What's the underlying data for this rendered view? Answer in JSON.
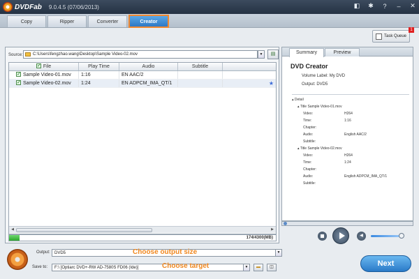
{
  "app": {
    "name": "DVDFab",
    "version": "9.0.4.5 (07/06/2013)"
  },
  "tabs": [
    {
      "label": "Copy"
    },
    {
      "label": "Ripper"
    },
    {
      "label": "Converter"
    },
    {
      "label": "Creator"
    }
  ],
  "task_queue": {
    "label": "Task Queue",
    "badge": "1"
  },
  "source": {
    "label": "Source:",
    "path": "C:\\Users\\fengzhao.wang\\Desktop\\Sample Video-02.mov"
  },
  "grid": {
    "headers": [
      "File",
      "Play Time",
      "Audio",
      "Subtitle"
    ],
    "rows": [
      {
        "file": "Sample Video-01.mov",
        "time": "1:16",
        "audio": "EN AAC/2",
        "subtitle": ""
      },
      {
        "file": "Sample Video-02.mov",
        "time": "1:24",
        "audio": "EN ADPCM_IMA_QT/1",
        "subtitle": ""
      }
    ]
  },
  "progress": {
    "text": "174/4300(MB)",
    "fraction": 0.04
  },
  "summary": {
    "tabs": [
      "Summary",
      "Preview"
    ],
    "title": "DVD Creator",
    "volume_label": "Volume Label: My DVD",
    "output": "Output: DVD5",
    "detail_label": "Detail",
    "titles": [
      {
        "name": "Title Sample Video-01.mov",
        "video": "H264",
        "time": "1:16",
        "chapter": "",
        "audio": "English AAC/2",
        "subtitle": ""
      },
      {
        "name": "Title Sample Video-02.mov",
        "video": "H264",
        "time": "1:24",
        "chapter": "",
        "audio": "English ADPCM_IMA_QT/1",
        "subtitle": ""
      }
    ],
    "field_labels": {
      "video": "Video:",
      "time": "Time:",
      "chapter": "Chapter:",
      "audio": "Audio:",
      "subtitle": "Subtitle:"
    }
  },
  "bottom": {
    "output_label": "Output:",
    "output_value": "DVD5",
    "output_hint": "Choose output size",
    "save_label": "Save to:",
    "save_value": "F:\\ [Optiarc DVD+-RW AD-7580S FD06 (Ide)]",
    "save_hint": "Choose target",
    "next_label": "Next"
  },
  "colors": {
    "accent": "#f08820",
    "tab_active": "#2d78c4"
  }
}
